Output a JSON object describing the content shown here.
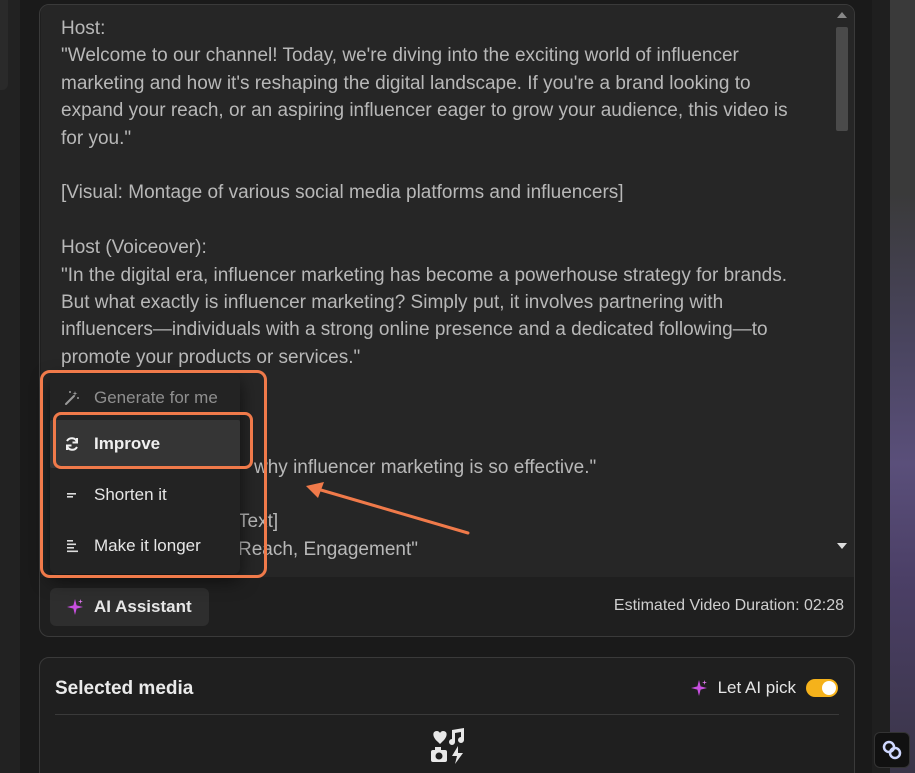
{
  "script": {
    "lines": [
      "Host:",
      "\"Welcome to our channel! Today, we're diving into the exciting world of influencer marketing and how it's reshaping the digital landscape. If you're a brand looking to expand your reach, or an aspiring influencer eager to grow your audience, this video is for you.\"",
      "",
      "[Visual: Montage of various social media platforms and influencers]",
      "",
      "Host (Voiceover):",
      "\"In the digital era, influencer marketing has become a powerhouse strategy for brands. But what exactly is influencer marketing? Simply put, it involves partnering with influencers—individuals with a strong online presence and a dedicated following—to promote your products or services.\""
    ],
    "partial_line_1": "why influencer marketing is so effective.\"",
    "partial_line_2": "Text]",
    "partial_line_3": "Reach, Engagement\""
  },
  "menu": {
    "items": [
      {
        "label": "Generate for me",
        "icon": "magic-wand-icon"
      },
      {
        "label": "Improve",
        "icon": "refresh-icon"
      },
      {
        "label": "Shorten it",
        "icon": "short-lines-icon"
      },
      {
        "label": "Make it longer",
        "icon": "long-lines-icon"
      }
    ]
  },
  "footer": {
    "ai_assistant_label": "AI Assistant",
    "duration_label": "Estimated Video Duration: 02:28"
  },
  "media": {
    "title": "Selected media",
    "let_ai_pick_label": "Let AI pick",
    "let_ai_pick_on": true
  },
  "colors": {
    "accent_orange": "#f07a4a",
    "toggle_yellow": "#f5b21b",
    "sparkle_purple": "#c84fe0"
  }
}
